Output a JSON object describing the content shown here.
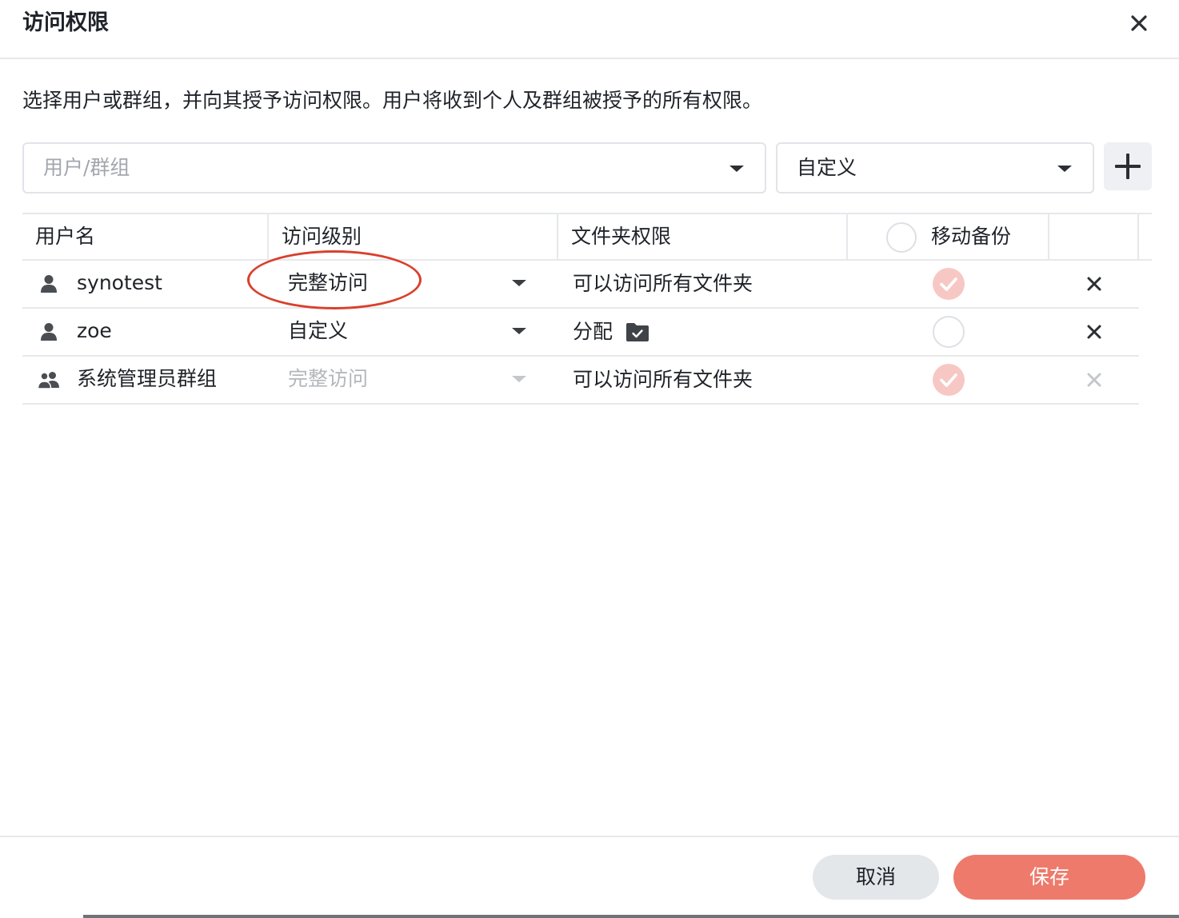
{
  "dialog": {
    "title": "访问权限",
    "close_icon": "close-icon"
  },
  "description": "选择用户或群组，并向其授予访问权限。用户将收到个人及群组被授予的所有权限。",
  "toolbar": {
    "user_select_placeholder": "用户/群组",
    "level_select_value": "自定义",
    "add_icon": "plus-icon"
  },
  "table": {
    "columns": {
      "user": "用户名",
      "level": "访问级别",
      "folder": "文件夹权限",
      "backup": "移动备份"
    },
    "rows": [
      {
        "icon": "user-icon",
        "name": "synotest",
        "level": "完整访问",
        "folder": "可以访问所有文件夹",
        "mobile_backup": true,
        "editable": true
      },
      {
        "icon": "user-icon",
        "name": "zoe",
        "level": "自定义",
        "folder": "分配",
        "folder_icon": "folder-check-icon",
        "mobile_backup": false,
        "editable": true
      },
      {
        "icon": "group-icon",
        "name": "系统管理员群组",
        "level": "完整访问",
        "folder": "可以访问所有文件夹",
        "mobile_backup": true,
        "editable": false
      }
    ]
  },
  "footer": {
    "cancel_label": "取消",
    "save_label": "保存"
  },
  "colors": {
    "accent": "#ee7a6b",
    "checked_fill": "#f7c8c3",
    "annotation": "#d9402c"
  }
}
